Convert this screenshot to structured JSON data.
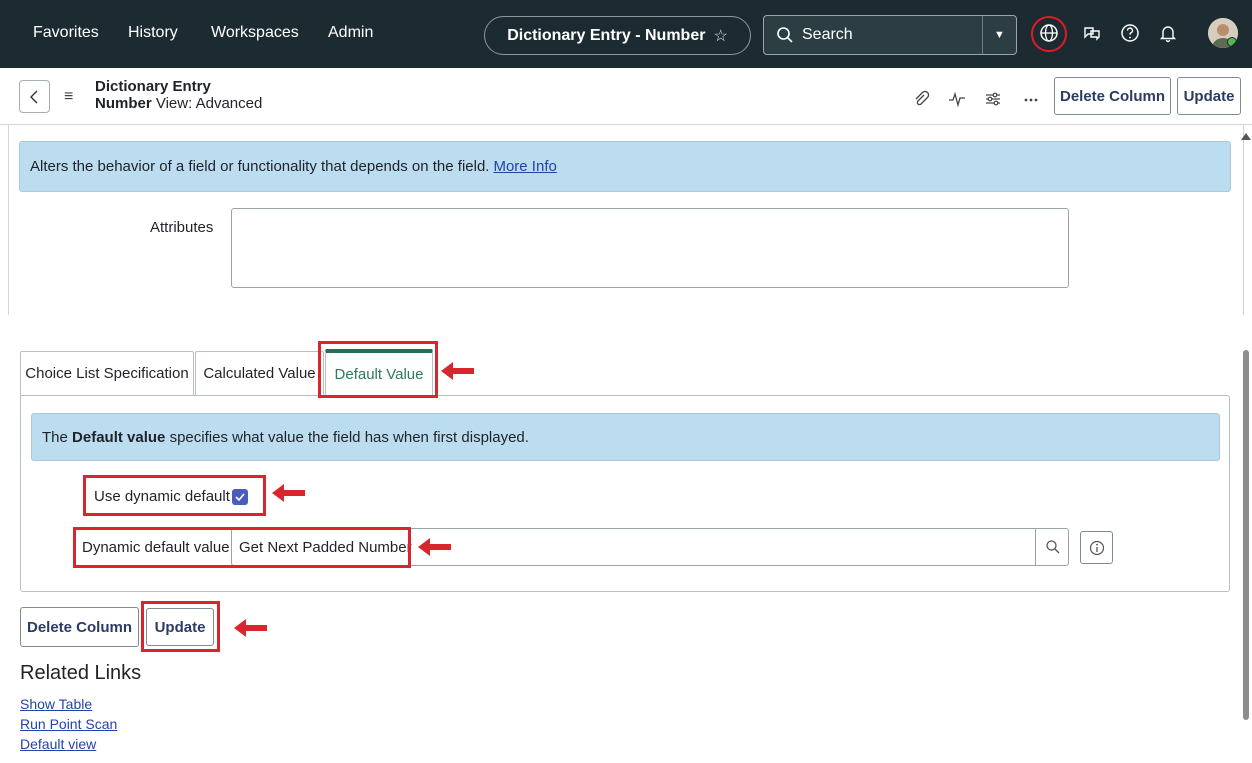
{
  "nav": {
    "links": [
      "Favorites",
      "History",
      "Workspaces",
      "Admin"
    ],
    "context_title": "Dictionary Entry - Number",
    "search_placeholder": "Search"
  },
  "header": {
    "title": "Dictionary Entry",
    "record": "Number",
    "view_label": "View: Advanced",
    "delete_label": "Delete Column",
    "update_label": "Update"
  },
  "attributes": {
    "info_text": "Alters the behavior of a field or functionality that depends on the field.",
    "more_info": "More Info",
    "label": "Attributes",
    "value": ""
  },
  "tabs": [
    {
      "label": "Choice List Specification",
      "active": false
    },
    {
      "label": "Calculated Value",
      "active": false
    },
    {
      "label": "Default Value",
      "active": true
    }
  ],
  "default_value": {
    "info_prefix": "The",
    "info_bold": "Default value",
    "info_suffix": "specifies what value the field has when first displayed.",
    "dynamic_label": "Use dynamic default",
    "dynamic_checked": true,
    "dynamic_value_label": "Dynamic default value",
    "dynamic_value": "Get Next Padded Number"
  },
  "footer": {
    "delete_label": "Delete Column",
    "update_label": "Update"
  },
  "related": {
    "title": "Related Links",
    "links": [
      "Show Table",
      "Run Point Scan",
      "Default view"
    ]
  },
  "colors": {
    "nav_bg": "#1c2b32",
    "accent_green": "#2b6d50",
    "info_bg": "#bcdcf0",
    "highlight_red": "#d8262c"
  }
}
